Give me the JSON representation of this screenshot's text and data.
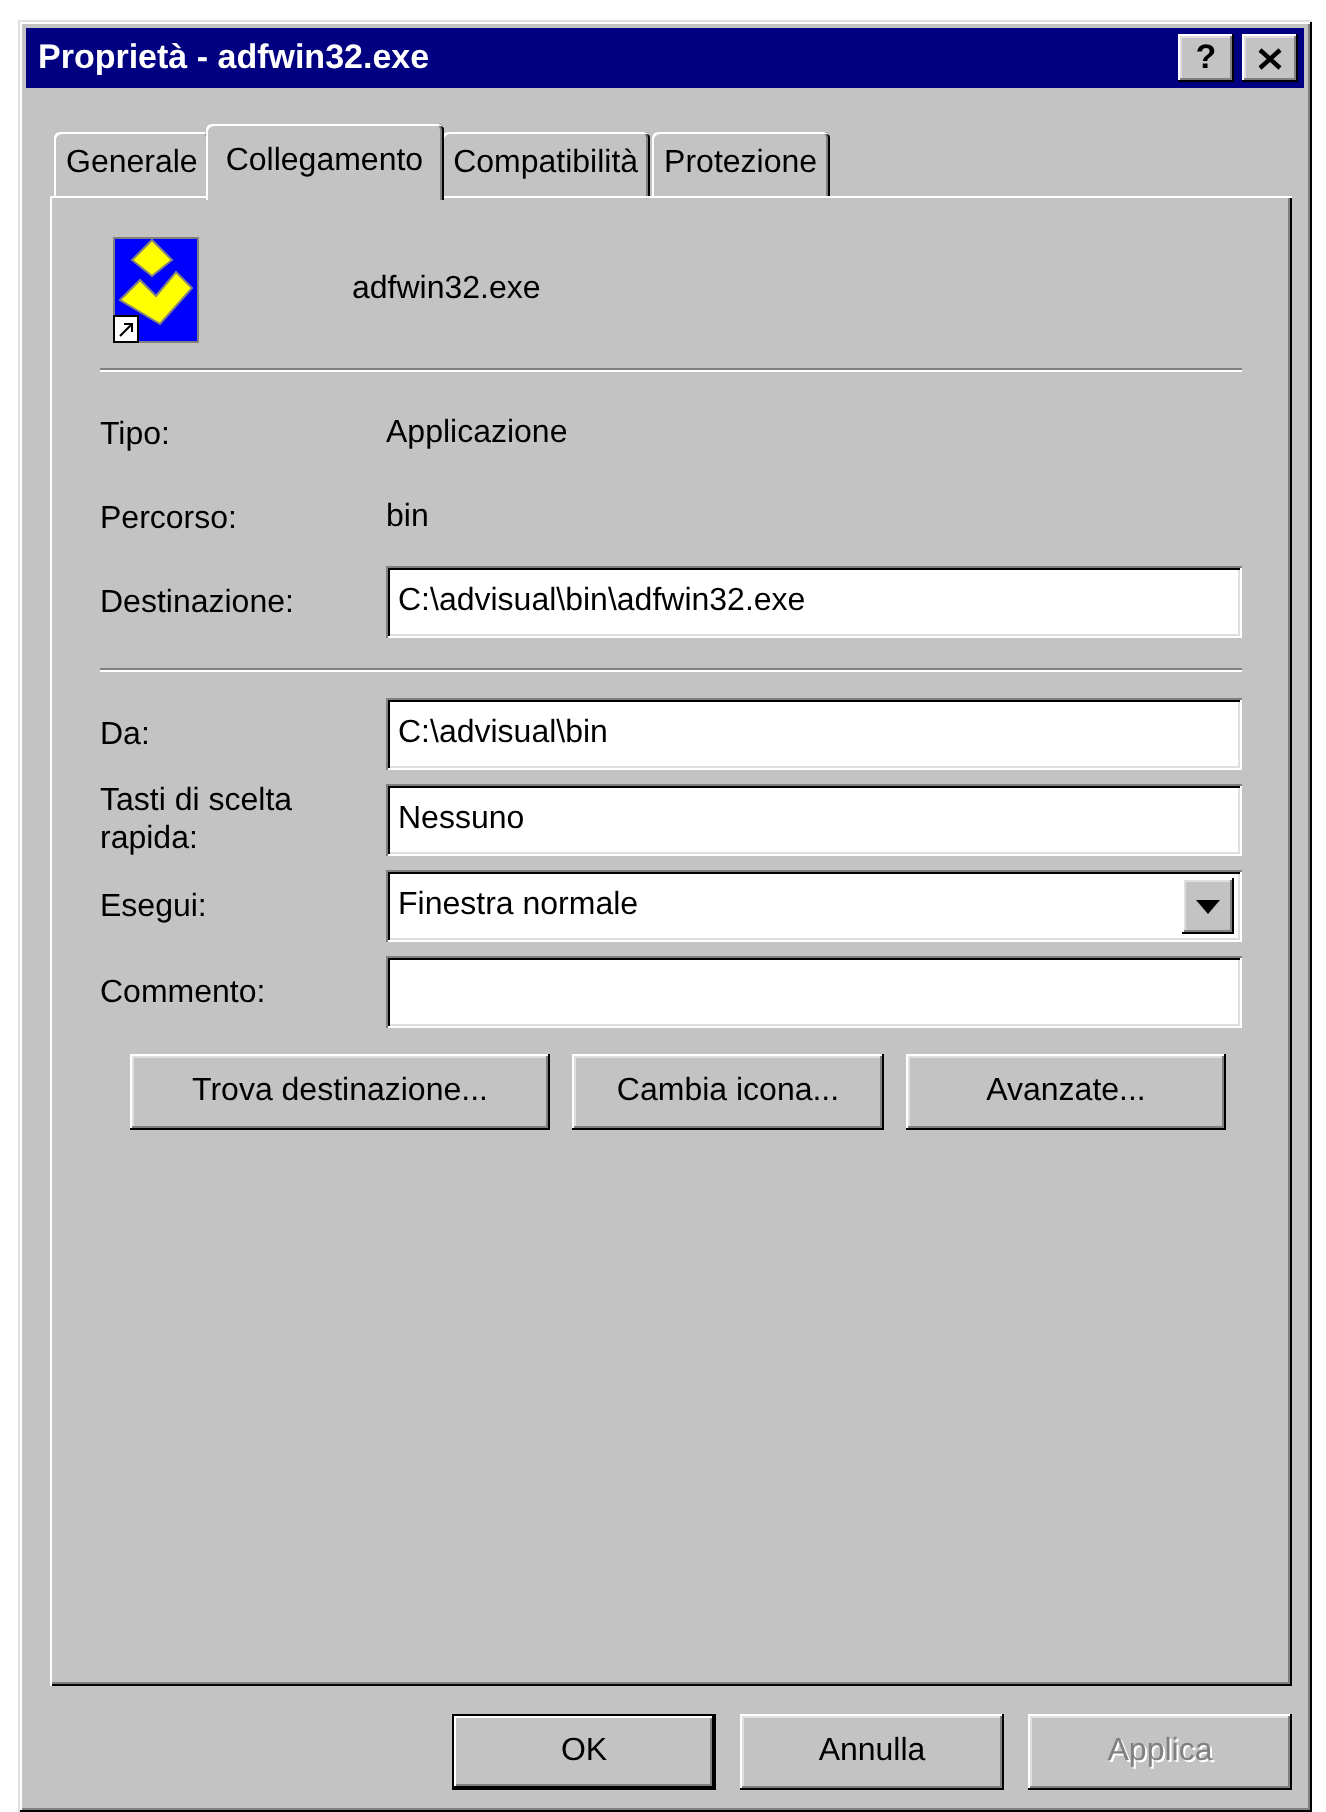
{
  "window": {
    "title": "Proprietà - adfwin32.exe",
    "help_button": "?"
  },
  "tabs": [
    {
      "label": "Generale",
      "selected": false
    },
    {
      "label": "Collegamento",
      "selected": true
    },
    {
      "label": "Compatibilità",
      "selected": false
    },
    {
      "label": "Protezione",
      "selected": false
    }
  ],
  "header": {
    "file_name": "adfwin32.exe"
  },
  "info": [
    {
      "label": "Tipo:",
      "value": "Applicazione"
    },
    {
      "label": "Percorso:",
      "value": "bin"
    },
    {
      "label": "Destinazione:",
      "value": "C:\\advisual\\bin\\adfwin32.exe",
      "kind": "field"
    }
  ],
  "settings": [
    {
      "label": "Da:",
      "value": "C:\\advisual\\bin",
      "kind": "field"
    },
    {
      "label": "Tasti di scelta rapida:",
      "value": "Nessuno",
      "kind": "field"
    },
    {
      "label": "Esegui:",
      "value": "Finestra normale",
      "kind": "dropdown"
    },
    {
      "label": "Commento:",
      "kind": "field"
    }
  ],
  "actions": [
    {
      "label": "Trova destinazione..."
    },
    {
      "label": "Cambia icona..."
    },
    {
      "label": "Avanzate..."
    }
  ],
  "buttons": [
    {
      "label": "OK",
      "default": true,
      "disabled": false
    },
    {
      "label": "Annulla",
      "default": false,
      "disabled": false
    },
    {
      "label": "Applica",
      "default": false,
      "disabled": true
    }
  ]
}
